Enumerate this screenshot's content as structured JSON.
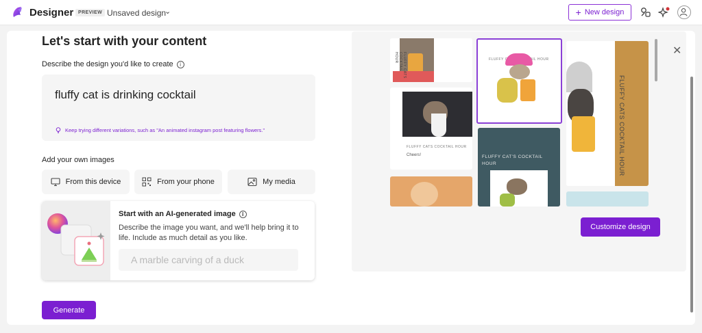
{
  "header": {
    "brand": "Designer",
    "badge": "PREVIEW",
    "design_name": "Unsaved design",
    "new_design_label": "New design",
    "icons": [
      "designer-logo-icon",
      "apps-icon",
      "sparkle-icon",
      "account-icon"
    ]
  },
  "content": {
    "heading": "Let's start with your content",
    "describe_label": "Describe the design you'd like to create",
    "prompt_value": "fluffy cat is drinking cocktail",
    "hint": "Keep trying different variations, such as \"An animated instagram post featuring flowers.\"",
    "images_label": "Add your own images",
    "sources": [
      {
        "label": "From this device",
        "icon": "monitor-icon"
      },
      {
        "label": "From your phone",
        "icon": "qr-code-icon"
      },
      {
        "label": "My media",
        "icon": "image-icon"
      }
    ],
    "ai": {
      "title": "Start with an AI-generated image",
      "description": "Describe the image you want, and we'll help bring it to life. Include as much detail as you like.",
      "placeholder": "A marble carving of a duck"
    },
    "generate_label": "Generate"
  },
  "preview": {
    "thumbnails": [
      {
        "text": "FLUFFY CATS COCKTAIL HOUR",
        "selected": false
      },
      {
        "text": "FLUFFY CATS COCKTAIL HOUR",
        "selected": true
      },
      {
        "text": "FLUFFY CATS COCKTAIL HOUR",
        "selected": false
      },
      {
        "text": "FLUFFY CATS COCKTAIL HOUR",
        "sub": "Cheers!",
        "selected": false
      },
      {
        "text": "FLUFFY CAT'S COCKTAIL HOUR",
        "selected": false
      }
    ],
    "customize_label": "Customize design"
  },
  "colors": {
    "accent": "#7b1fd1",
    "panel": "#f5f5f5"
  }
}
